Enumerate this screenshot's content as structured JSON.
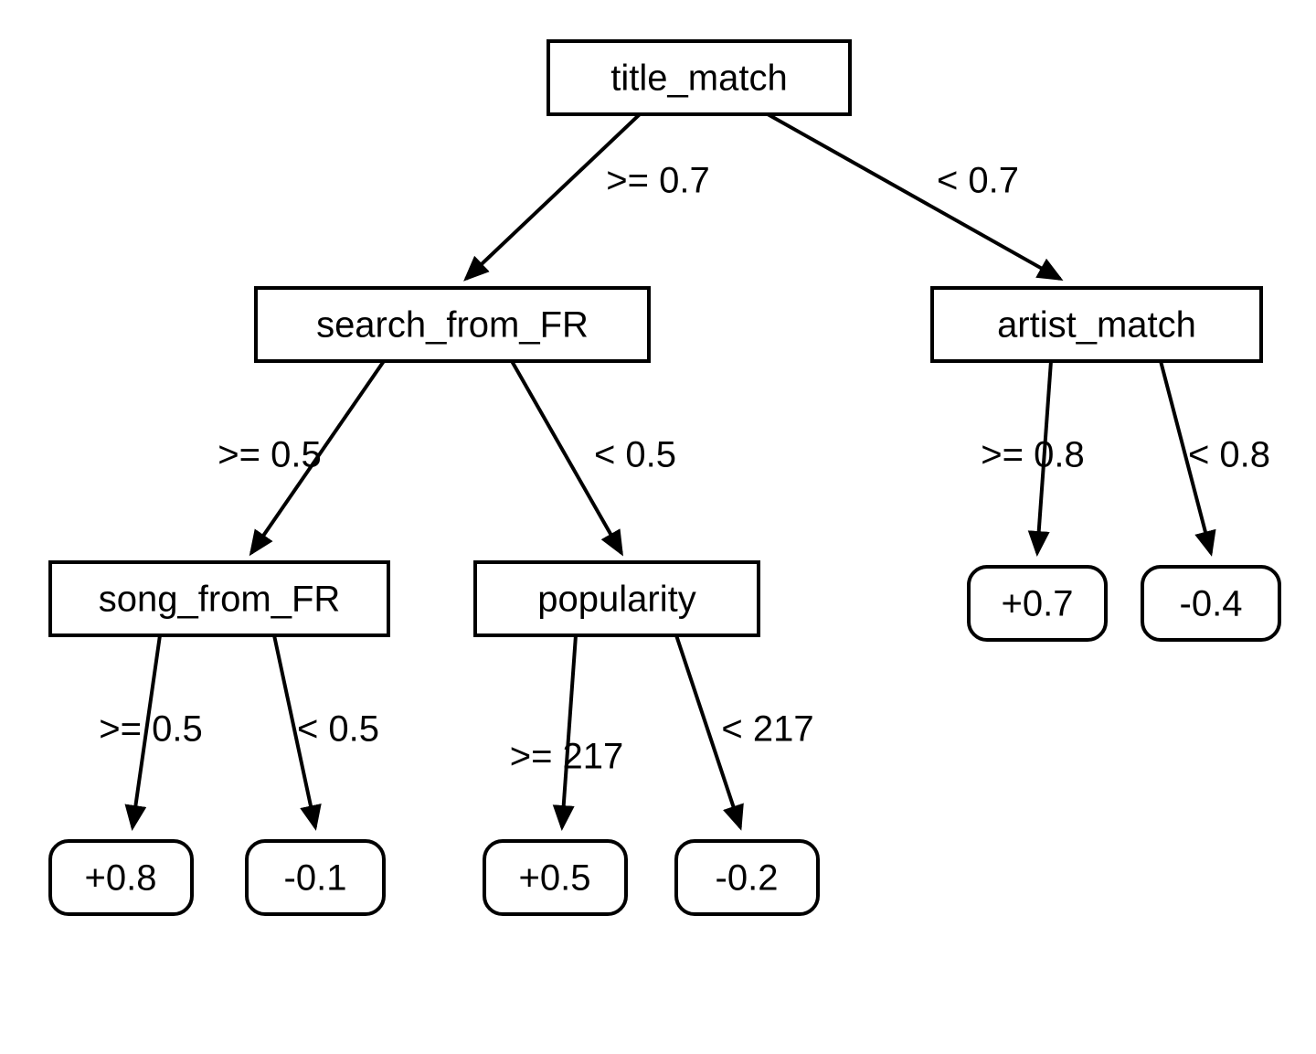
{
  "tree": {
    "root": {
      "label": "title_match",
      "left_edge": ">= 0.7",
      "right_edge": "< 0.7",
      "left": {
        "label": "search_from_FR",
        "left_edge": ">= 0.5",
        "right_edge": "< 0.5",
        "left": {
          "label": "song_from_FR",
          "left_edge": ">= 0.5",
          "right_edge": "< 0.5",
          "left_leaf": "+0.8",
          "right_leaf": "-0.1"
        },
        "right": {
          "label": "popularity",
          "left_edge": ">= 217",
          "right_edge": "< 217",
          "left_leaf": "+0.5",
          "right_leaf": "-0.2"
        }
      },
      "right": {
        "label": "artist_match",
        "left_edge": ">= 0.8",
        "right_edge": "< 0.8",
        "left_leaf": "+0.7",
        "right_leaf": "-0.4"
      }
    }
  }
}
